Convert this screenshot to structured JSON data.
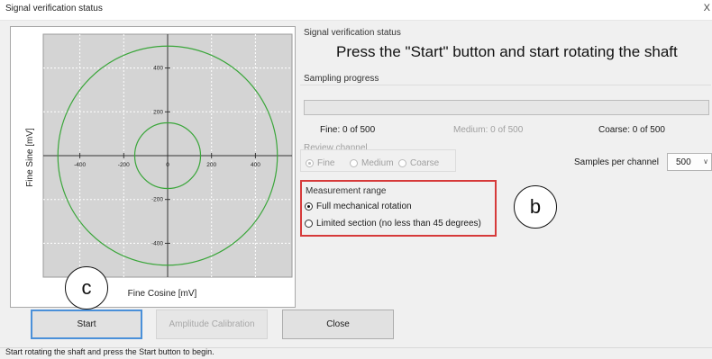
{
  "window": {
    "title": "Signal verification status",
    "close_glyph": "X"
  },
  "plot": {
    "xlabel": "Fine Cosine [mV]",
    "ylabel": "Fine Sine [mV]",
    "ticks_x": [
      "-400",
      "-200",
      "0",
      "200",
      "400"
    ],
    "ticks_y": [
      "400",
      "200",
      "0",
      "-200",
      "-400"
    ],
    "circle_color": "#3aa63a",
    "background": "#d4d4d4",
    "circle_radii_mv": [
      500,
      150
    ]
  },
  "status": {
    "group_label": "Signal verification status",
    "message": "Press the \"Start\" button and start rotating the shaft"
  },
  "sampling": {
    "label": "Sampling progress",
    "progress": 0,
    "fine": "Fine: 0 of 500",
    "medium": "Medium: 0 of 500",
    "coarse": "Coarse: 0 of 500"
  },
  "review": {
    "label": "Review channel",
    "options": [
      "Fine",
      "Medium",
      "Coarse"
    ],
    "selected": "Fine"
  },
  "samples": {
    "label": "Samples per channel",
    "value": "500"
  },
  "measurement": {
    "label": "Measurement range",
    "options": [
      "Full mechanical rotation",
      "Limited section (no less than 45 degrees)"
    ],
    "selected": "Full mechanical rotation"
  },
  "callouts": {
    "b": "b",
    "c": "c"
  },
  "buttons": {
    "start": "Start",
    "amplitude": "Amplitude Calibration",
    "close": "Close"
  },
  "statusbar": "Start rotating the shaft and press the Start button to begin.",
  "colors": {
    "highlight_box": "#d63a3a",
    "default_button_border": "#4a90d9"
  }
}
